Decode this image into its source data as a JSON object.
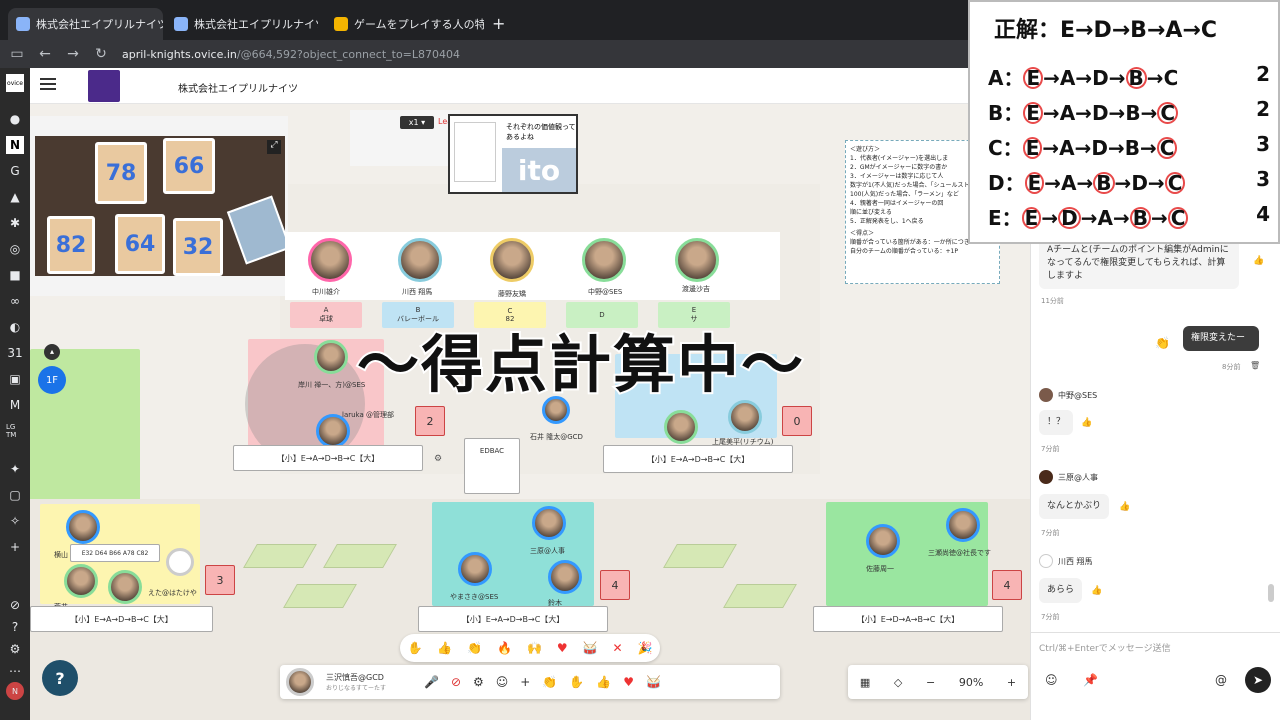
{
  "browser": {
    "tabs": [
      {
        "label": "株式会社エイプリルナイツ | ovic"
      },
      {
        "label": "株式会社エイプリルナイツ | ovice"
      },
      {
        "label": "ゲームをプレイする人の特性・共通項を整"
      }
    ],
    "url_host": "april-knights.ovice.in",
    "url_rest": "/@664,592?object_connect_to=L870404"
  },
  "header": {
    "company": "株式会社エイプリルナイツ"
  },
  "space": {
    "speaker": {
      "zoom": "x1",
      "leave": "Leave",
      "slide_title": "それぞれの価値観って あるよね",
      "slide_ito": "ito"
    },
    "top_avatars": [
      {
        "name": "中川雄介"
      },
      {
        "name": "川西 翔馬"
      },
      {
        "name": "藤野友矯"
      },
      {
        "name": "中野@SES"
      },
      {
        "name": "渡邊沙吉"
      }
    ],
    "column_tags": [
      {
        "letter": "A",
        "text": "卓球"
      },
      {
        "letter": "B",
        "text": "バレーボール"
      },
      {
        "letter": "C",
        "text": "82"
      },
      {
        "letter": "D",
        "text": ""
      },
      {
        "letter": "E",
        "text": "サ"
      }
    ],
    "rules": {
      "title": "＜遊び方＞",
      "lines": [
        "1．代表者(イメージャー)を選出しま",
        "2．GMがイメージャーに数字の書か",
        "3．イメージャーは数字に応じて人",
        "数字が1(不人気)だった場合、「シュールスト",
        "100(人気)だった場合、「ラーメン」など",
        "4．親著者一同はイメージャーの回",
        "順に並び変える",
        "5．正解発表をし、1へ戻る"
      ],
      "points_title": "＜得点＞",
      "points": [
        "順番が合っている箇所がある：一か所につき1P",
        "自分のチームの順番が合っている：+1P"
      ]
    },
    "floor": "1F",
    "team_names": {
      "left": "岸川 禅一、方)@SES",
      "laruka": "laruka @管理部",
      "ishii": "石井 隆太@GCD",
      "ueno": "上尾美平(リチウム)"
    },
    "answer_boxes": [
      "【小】E→A→D→B→C【大】",
      "【小】E→A→D→B→C【大】",
      "【小】E→A→D→B→C【大】",
      "【小】E→A→D→B→C【大】",
      "【小】E→D→A→B→C【大】"
    ],
    "scores": [
      "2",
      "0",
      "3",
      "4",
      "4"
    ],
    "edbac": "EDBAC",
    "bottom_names": [
      "横山",
      "E32 D64 B66 A78 C82",
      "荒井",
      "えた@はたけや",
      "三原@人事",
      "やまさき@SES",
      "鈴木",
      "佐藤周一",
      "三瀬尚徳@社長です"
    ],
    "overlay_text": "～得点計算中～",
    "me": {
      "name": "三沢慎吾@GCD",
      "status": "おりじなるすてーたす"
    },
    "zoom": "90%"
  },
  "chat": {
    "messages": [
      {
        "text": "Aチームと(チームのポイント編集がAdminになってるんで権限変更してもらえれば、計算しますよ",
        "time": "11分前"
      },
      {
        "text": "権限変えたー",
        "time": "8分前",
        "mine": true
      },
      {
        "user": "中野@SES",
        "text": "！？",
        "time": "7分前"
      },
      {
        "user": "三原@人事",
        "text": "なんとかぶり",
        "time": "7分前"
      },
      {
        "user": "川西 翔馬",
        "text": "あらら",
        "time": "7分前"
      }
    ],
    "placeholder": "Ctrl/⌘+Enterでメッセージ送信"
  },
  "answer": {
    "header": "正解：E→D→B→A→C",
    "rows": [
      {
        "label": "A",
        "seq": [
          "E",
          "A",
          "D",
          "B",
          "C"
        ],
        "circled": [
          0,
          3
        ],
        "points": "2"
      },
      {
        "label": "B",
        "seq": [
          "E",
          "A",
          "D",
          "B",
          "C"
        ],
        "circled": [
          0,
          4
        ],
        "points": "2"
      },
      {
        "label": "C",
        "seq": [
          "E",
          "A",
          "D",
          "B",
          "C"
        ],
        "circled": [
          0,
          4
        ],
        "points": "3"
      },
      {
        "label": "D",
        "seq": [
          "E",
          "A",
          "B",
          "D",
          "C"
        ],
        "circled": [
          0,
          2,
          4
        ],
        "points": "3"
      },
      {
        "label": "E",
        "seq": [
          "E",
          "D",
          "A",
          "B",
          "C"
        ],
        "circled": [
          0,
          1,
          3,
          4
        ],
        "points": "4"
      }
    ]
  }
}
